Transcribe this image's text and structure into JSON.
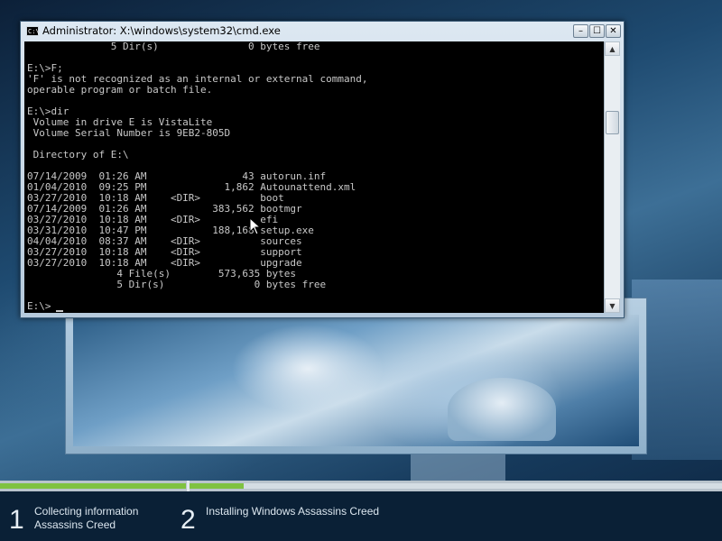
{
  "window": {
    "title": "Administrator: X:\\windows\\system32\\cmd.exe",
    "icon_text": "C:\\",
    "buttons": {
      "minimize": "–",
      "maximize": "☐",
      "close": "✕"
    }
  },
  "console": {
    "lines": [
      "              5 Dir(s)               0 bytes free",
      "",
      "E:\\>F;",
      "'F' is not recognized as an internal or external command,",
      "operable program or batch file.",
      "",
      "E:\\>dir",
      " Volume in drive E is VistaLite",
      " Volume Serial Number is 9EB2-805D",
      "",
      " Directory of E:\\",
      "",
      "07/14/2009  01:26 AM                43 autorun.inf",
      "01/04/2010  09:25 PM             1,862 Autounattend.xml",
      "03/27/2010  10:18 AM    <DIR>          boot",
      "07/14/2009  01:26 AM           383,562 bootmgr",
      "03/27/2010  10:18 AM    <DIR>          efi",
      "03/31/2010  10:47 PM           188,168 setup.exe",
      "04/04/2010  08:37 AM    <DIR>          sources",
      "03/27/2010  10:18 AM    <DIR>          support",
      "03/27/2010  10:18 AM    <DIR>          upgrade",
      "               4 File(s)        573,635 bytes",
      "               5 Dir(s)               0 bytes free",
      "",
      "E:\\>"
    ]
  },
  "scrollbar": {
    "up_arrow": "▲",
    "down_arrow": "▼"
  },
  "progress": {
    "step1_fraction_filled": 1.0,
    "step2_fraction_filled": 0.11,
    "fill_color": "#7fc241"
  },
  "steps": [
    {
      "number": "1",
      "line1": "Collecting information",
      "line2": "Assassins Creed"
    },
    {
      "number": "2",
      "line1": "Installing Windows Assassins Creed"
    }
  ],
  "icons": {
    "cmd": "command-prompt-icon",
    "pointer": "mouse-pointer-icon"
  }
}
